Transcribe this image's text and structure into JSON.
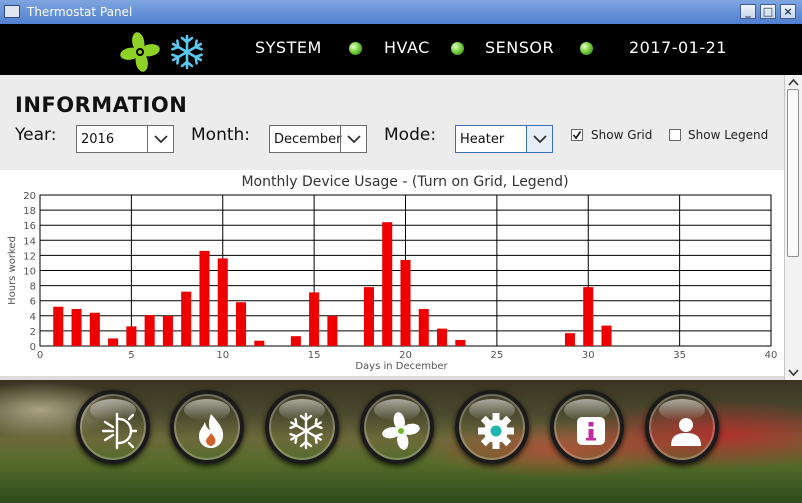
{
  "window": {
    "title": "Thermostat Panel",
    "buttons": [
      "minimize",
      "maximize",
      "close"
    ]
  },
  "topbar": {
    "icons": [
      "fan-icon",
      "snowflake-icon"
    ],
    "status_items": [
      {
        "label": "SYSTEM",
        "led_color": "#6bd23a"
      },
      {
        "label": "HVAC",
        "led_color": "#6bd23a"
      },
      {
        "label": "SENSOR",
        "led_color": "#6bd23a"
      }
    ],
    "date": "2017-01-21"
  },
  "info": {
    "heading": "INFORMATION",
    "year": {
      "label": "Year:",
      "value": "2016"
    },
    "month": {
      "label": "Month:",
      "value": "December"
    },
    "mode": {
      "label": "Mode:",
      "value": "Heater"
    },
    "show_grid": {
      "label": "Show Grid",
      "checked": true
    },
    "show_legend": {
      "label": "Show Legend",
      "checked": false
    }
  },
  "chart_data": {
    "type": "bar",
    "title": "Monthly Device Usage - (Turn on Grid, Legend)",
    "xlabel": "Days in December",
    "ylabel": "Hours worked",
    "xlim": [
      0,
      40
    ],
    "ylim": [
      0,
      20
    ],
    "xticks": [
      0,
      5,
      10,
      15,
      20,
      25,
      30,
      35,
      40
    ],
    "yticks": [
      0,
      2,
      4,
      6,
      8,
      10,
      12,
      14,
      16,
      18,
      20
    ],
    "grid": true,
    "legend": false,
    "bar_color": "#ee0000",
    "x": [
      1,
      2,
      3,
      4,
      5,
      6,
      7,
      8,
      9,
      10,
      11,
      12,
      14,
      15,
      16,
      18,
      19,
      20,
      21,
      22,
      23,
      29,
      30,
      31
    ],
    "values": [
      5.2,
      4.9,
      4.4,
      1.0,
      2.6,
      4.1,
      4.0,
      7.2,
      12.6,
      11.6,
      5.8,
      0.7,
      1.3,
      7.1,
      4.0,
      7.8,
      16.4,
      11.4,
      4.9,
      2.3,
      0.8,
      1.7,
      7.8,
      2.7
    ]
  },
  "nav_buttons": [
    {
      "name": "sun-snowflake-icon",
      "color": "#c9b52a"
    },
    {
      "name": "flame-icon",
      "color": "#d0632c"
    },
    {
      "name": "snowflake-icon",
      "color": "#2d74c4"
    },
    {
      "name": "fan-icon",
      "color": "#74b82a"
    },
    {
      "name": "gear-icon",
      "color": "#1fb6b0"
    },
    {
      "name": "info-icon",
      "color": "#c02c9c"
    },
    {
      "name": "user-icon",
      "color": "#5a3fd0"
    }
  ]
}
